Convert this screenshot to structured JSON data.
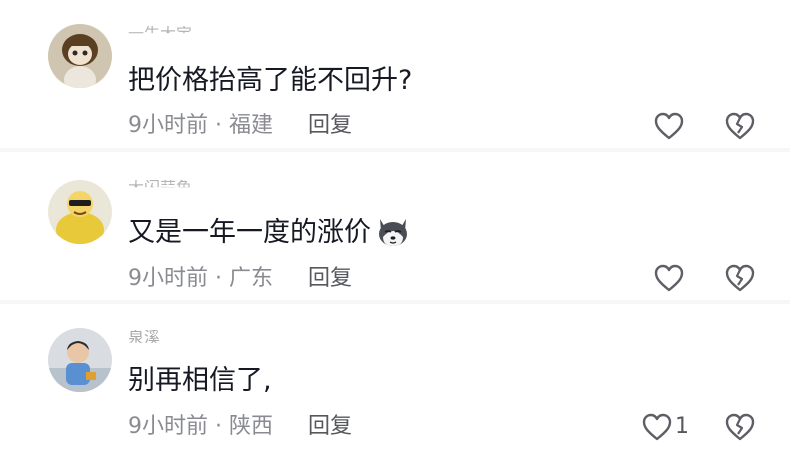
{
  "comments": [
    {
      "username": "一牛大宝",
      "text": "把价格抬高了能不回升?",
      "time": "9小时前",
      "separator": "·",
      "location": "福建",
      "reply_label": "回复",
      "like_count": ""
    },
    {
      "username": "大闪蒜鱼",
      "text": "又是一年一度的涨价",
      "emoji": "husky-dog-emoji",
      "time": "9小时前",
      "separator": "·",
      "location": "广东",
      "reply_label": "回复",
      "like_count": ""
    },
    {
      "username": "泉溪",
      "text": "别再相信了,",
      "time": "9小时前",
      "separator": "·",
      "location": "陕西",
      "reply_label": "回复",
      "like_count": "1"
    }
  ],
  "colors": {
    "text": "#161823",
    "meta": "#8a8b91",
    "reply": "#57585e",
    "icon": "#5e5f66",
    "divider": "#f7f7f8"
  }
}
